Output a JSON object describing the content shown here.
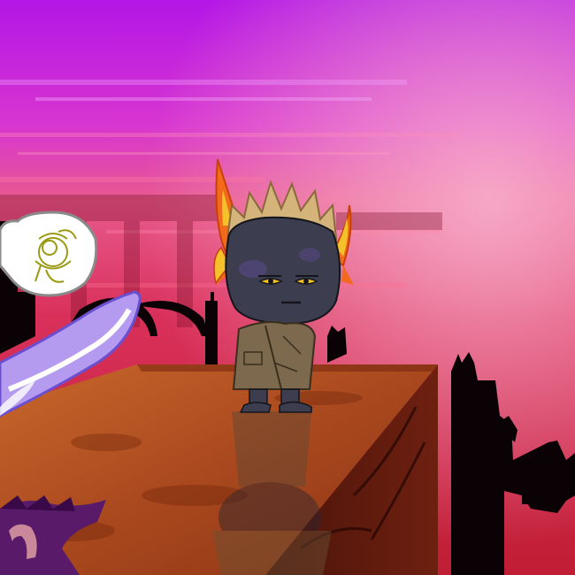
{
  "scene": {
    "colors": {
      "sky_top": "#c418e8",
      "sky_mid": "#e0427a",
      "sky_low": "#c8203c",
      "glow": "#f7a0c0",
      "silhouette": "#0a0204",
      "platform_top": "#b0562a",
      "platform_dark": "#5a1a0c",
      "platform_edge": "#7a2810",
      "skin": "#3c3d4e",
      "coat": "#7d6a4e",
      "hair": "#d4b47a",
      "horn_orange": "#f26a1c",
      "horn_yellow": "#f5c12a",
      "eye_yellow": "#f2c21a",
      "blade": "#b49bf0",
      "shadow_purple": "#5a1a6a"
    },
    "icons": [
      "flower-speech-bubble-icon",
      "spade-blade-icon"
    ]
  }
}
